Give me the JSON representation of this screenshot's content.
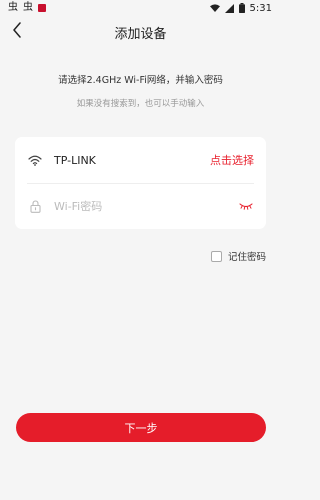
{
  "status_bar": {
    "left_glyphs": [
      "虫",
      "虫"
    ],
    "time": "5:31",
    "icons": [
      "wifi-icon",
      "signal-icon",
      "battery-icon"
    ]
  },
  "nav": {
    "title": "添加设备",
    "back_icon": "chevron-left-icon"
  },
  "instruction": "请选择2.4GHz Wi-Fi网络，并输入密码",
  "hint": "如果没有搜索到，也可以手动输入",
  "wifi_card": {
    "ssid": "TP-LINK",
    "select_label": "点击选择",
    "password_value": "",
    "password_placeholder": "Wi-Fi密码",
    "accent_color": "#e8212e"
  },
  "remember": {
    "label": "记住密码",
    "checked": false
  },
  "next_button": {
    "label": "下一步",
    "color": "#e51d2a"
  }
}
